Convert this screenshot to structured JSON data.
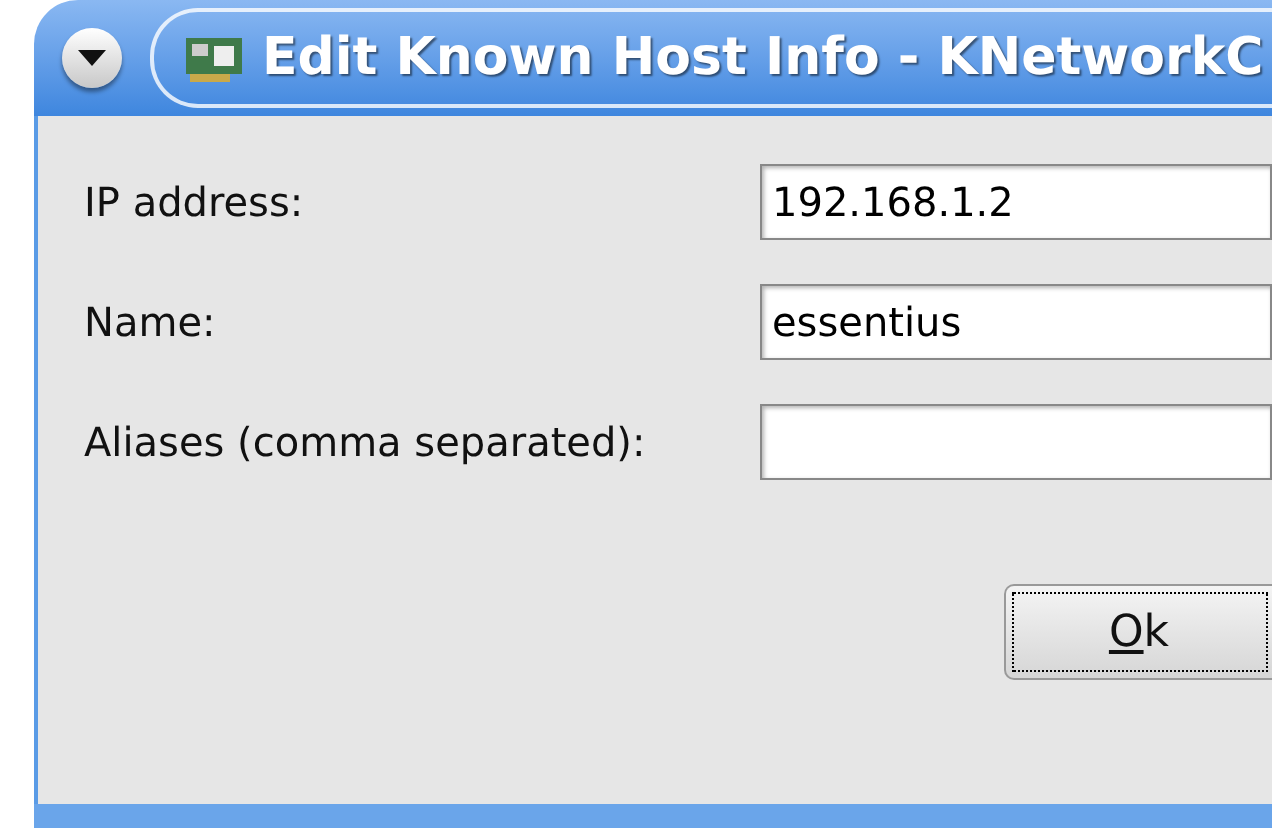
{
  "window": {
    "title": "Edit Known Host Info - KNetworkC"
  },
  "fields": [
    {
      "label": "IP address:",
      "value": "192.168.1.2"
    },
    {
      "label": "Name:",
      "value": "essentius"
    },
    {
      "label": "Aliases (comma separated):"
    }
  ],
  "buttons": [
    {
      "label": "Ok",
      "first_letter_underlined": true,
      "focused": true
    }
  ]
}
